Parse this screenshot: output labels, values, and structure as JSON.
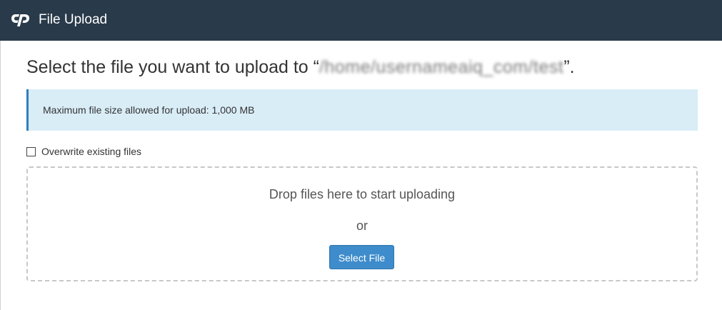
{
  "header": {
    "logo_icon": "cpanel-logo-icon",
    "title": "File Upload"
  },
  "page": {
    "heading_prefix": "Select the file you want to upload to “",
    "upload_path": "/home/usernameaiq_com/test",
    "heading_suffix": "”."
  },
  "alert": {
    "text": "Maximum file size allowed for upload: 1,000 MB"
  },
  "options": {
    "overwrite_label": "Overwrite existing files",
    "overwrite_checked": false
  },
  "dropzone": {
    "drop_text": "Drop files here to start uploading",
    "or_text": "or",
    "select_button_label": "Select File"
  },
  "colors": {
    "header_bg": "#293a4a",
    "alert_bg": "#d9edf7",
    "alert_border": "#2f7fbd",
    "primary_button": "#3e8ccb"
  }
}
